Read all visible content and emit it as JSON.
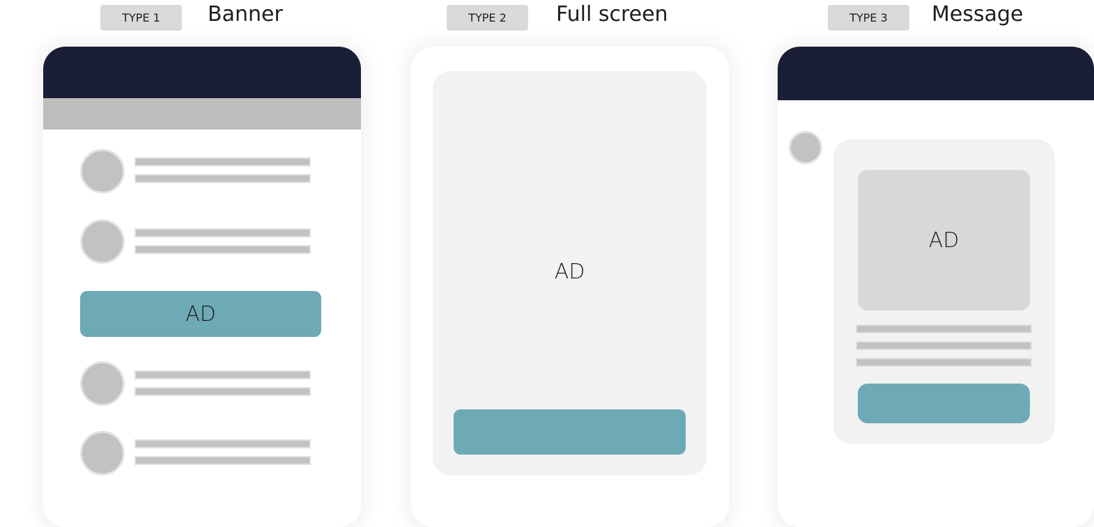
{
  "types": [
    {
      "badge": "TYPE 1",
      "title": "Banner"
    },
    {
      "badge": "TYPE 2",
      "title": "Full screen"
    },
    {
      "badge": "TYPE 3",
      "title": "Message"
    }
  ],
  "banner": {
    "ad_label": "AD",
    "list_items": 4
  },
  "fullscreen": {
    "ad_label": "AD"
  },
  "message": {
    "ad_label": "AD"
  },
  "colors": {
    "header_dark": "#1a1e36",
    "accent_teal": "#6ea9b6",
    "placeholder_grey": "#c2c2c2",
    "panel_light": "#f2f2f2"
  }
}
